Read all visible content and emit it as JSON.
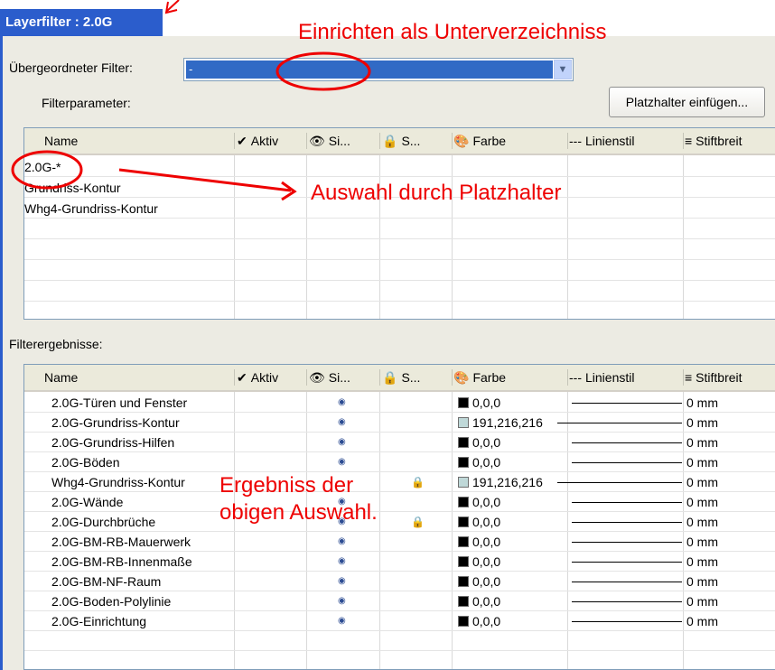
{
  "window": {
    "title": "Layerfilter : 2.0G"
  },
  "filter": {
    "parent_label": "Übergeordneter Filter:",
    "parent_value": "-",
    "params_label": "Filterparameter:",
    "placeholder_button": "Platzhalter einfügen...",
    "results_label": "Filterergebnisse:"
  },
  "columns": [
    {
      "label": "Name",
      "icon": ""
    },
    {
      "label": "Aktiv",
      "icon": "✔"
    },
    {
      "label": "Si...",
      "icon": "👁"
    },
    {
      "label": "S...",
      "icon": "🔒"
    },
    {
      "label": "Farbe",
      "icon": "🎨"
    },
    {
      "label": "Linienstil",
      "icon": "---"
    },
    {
      "label": "Stiftbreit",
      "icon": "≡"
    }
  ],
  "params_rows": [
    {
      "name": "2.0G-*"
    },
    {
      "name": "Grundriss-Kontur"
    },
    {
      "name": "Whg4-Grundriss-Kontur"
    }
  ],
  "results_rows": [
    {
      "name": "2.0G-Türen und Fenster",
      "visible": true,
      "locked": false,
      "color": "#000000",
      "color_text": "0,0,0",
      "pen": "0 mm"
    },
    {
      "name": "2.0G-Grundriss-Kontur",
      "visible": true,
      "locked": false,
      "color": "#bfd8d8",
      "color_text": "191,216,216",
      "pen": "0 mm"
    },
    {
      "name": "2.0G-Grundriss-Hilfen",
      "visible": true,
      "locked": false,
      "color": "#000000",
      "color_text": "0,0,0",
      "pen": "0 mm"
    },
    {
      "name": "2.0G-Böden",
      "visible": true,
      "locked": false,
      "color": "#000000",
      "color_text": "0,0,0",
      "pen": "0 mm"
    },
    {
      "name": "Whg4-Grundriss-Kontur",
      "visible": false,
      "locked": true,
      "color": "#bfd8d8",
      "color_text": "191,216,216",
      "pen": "0 mm"
    },
    {
      "name": "2.0G-Wände",
      "visible": true,
      "locked": false,
      "color": "#000000",
      "color_text": "0,0,0",
      "pen": "0 mm"
    },
    {
      "name": "2.0G-Durchbrüche",
      "visible": true,
      "locked": true,
      "color": "#000000",
      "color_text": "0,0,0",
      "pen": "0 mm"
    },
    {
      "name": "2.0G-BM-RB-Mauerwerk",
      "visible": true,
      "locked": false,
      "color": "#000000",
      "color_text": "0,0,0",
      "pen": "0 mm"
    },
    {
      "name": "2.0G-BM-RB-Innenmaße",
      "visible": true,
      "locked": false,
      "color": "#000000",
      "color_text": "0,0,0",
      "pen": "0 mm"
    },
    {
      "name": "2.0G-BM-NF-Raum",
      "visible": true,
      "locked": false,
      "color": "#000000",
      "color_text": "0,0,0",
      "pen": "0 mm"
    },
    {
      "name": "2.0G-Boden-Polylinie",
      "visible": true,
      "locked": false,
      "color": "#000000",
      "color_text": "0,0,0",
      "pen": "0 mm"
    },
    {
      "name": "2.0G-Einrichtung",
      "visible": true,
      "locked": false,
      "color": "#000000",
      "color_text": "0,0,0",
      "pen": "0 mm"
    }
  ],
  "annotations": {
    "subdirectory": "Einrichten als Unterverzeichniss",
    "placeholder_selection": "Auswahl durch Platzhalter",
    "result_line1": "Ergebniss der",
    "result_line2": "obigen Auswahl."
  },
  "colors": {
    "title_bar": "#2b5dcc",
    "annotation": "#ee0000",
    "selection": "#316ac5"
  }
}
